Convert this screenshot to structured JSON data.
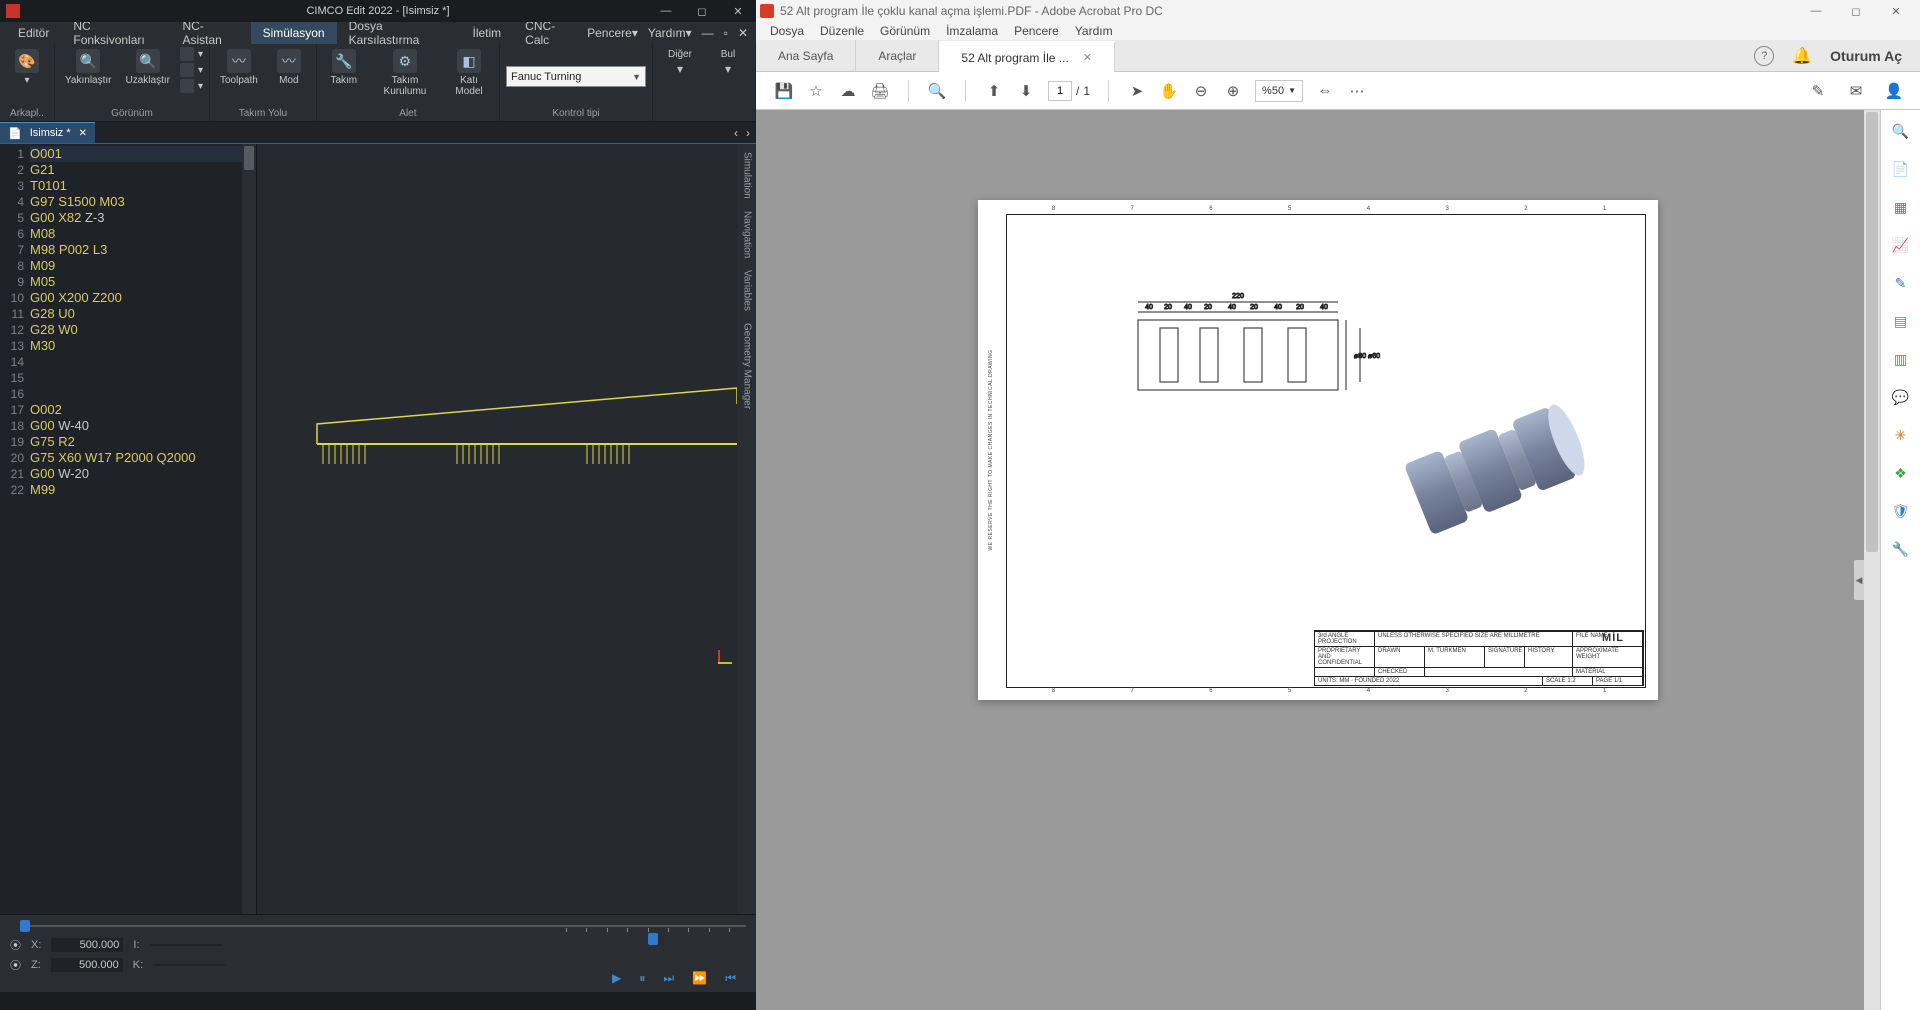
{
  "cimco": {
    "title": "CIMCO Edit 2022 - [Isimsiz *]",
    "menu": [
      "Editör",
      "NC Fonksiyonları",
      "NC-Asistan",
      "Simülasyon",
      "Dosya Karşılaştırma",
      "İletim",
      "CNC-Calc"
    ],
    "menu_active": 3,
    "menu_right": {
      "pencere": "Pencere",
      "yardim": "Yardım"
    },
    "ribbon": {
      "g1": {
        "label": "Arkapl..",
        "b1": ""
      },
      "g2": {
        "label": "Görünüm",
        "b1": "Yakınlaştır",
        "b2": "Uzaklaştır"
      },
      "g3": {
        "label": "Takım Yolu",
        "b1": "Toolpath",
        "b2": "Mod"
      },
      "g4": {
        "label": "Alet",
        "b1": "Takım",
        "b2": "Takım\nKurulumu",
        "b3": "Katı\nModel"
      },
      "g5": {
        "label": "Kontrol tipi",
        "combo": "Fanuc Turning"
      },
      "g6": {
        "b1": "Diğer",
        "b2": "Bul"
      }
    },
    "doc_tab": "Isimsiz *",
    "code_lines": [
      "O001",
      "G21",
      "T0101",
      "G97 S1500 M03",
      "G00 X82 Z-3",
      "M08",
      "M98 P002 L3",
      "M09",
      "M05",
      "G00 X200 Z200",
      "G28 U0",
      "G28 W0",
      "M30",
      "",
      "",
      "",
      "O002",
      "G00 W-40",
      "G75 R2",
      "G75 X60 W17 P2000 Q2000",
      "G00 W-20",
      "M99"
    ],
    "side_rail": [
      "Simulation",
      "Navigation",
      "Variables",
      "Geometry Manager"
    ],
    "coords": {
      "x_label": "X:",
      "x": "500.000",
      "z_label": "Z:",
      "z": "500.000",
      "i_label": "I:",
      "k_label": "K:"
    }
  },
  "acrobat": {
    "title": "52 Alt program İle çoklu kanal açma işlemi.PDF - Adobe Acrobat Pro DC",
    "menu": [
      "Dosya",
      "Düzenle",
      "Görünüm",
      "İmzalama",
      "Pencere",
      "Yardım"
    ],
    "tab_home": "Ana Sayfa",
    "tab_tools": "Araçlar",
    "tab_doc": "52 Alt program İle ...",
    "login": "Oturum Aç",
    "page_cur": "1",
    "page_sep": "/",
    "page_tot": "1",
    "zoom": "%50",
    "drawing": {
      "overall": "220",
      "segs": [
        "40",
        "20",
        "40",
        "20",
        "40",
        "20",
        "40",
        "20",
        "40"
      ],
      "dia_outer": "⌀80",
      "dia_inner": "⌀60",
      "mil": "MİL",
      "ruler": [
        "8",
        "7",
        "6",
        "5",
        "4",
        "3",
        "2",
        "1"
      ]
    }
  }
}
